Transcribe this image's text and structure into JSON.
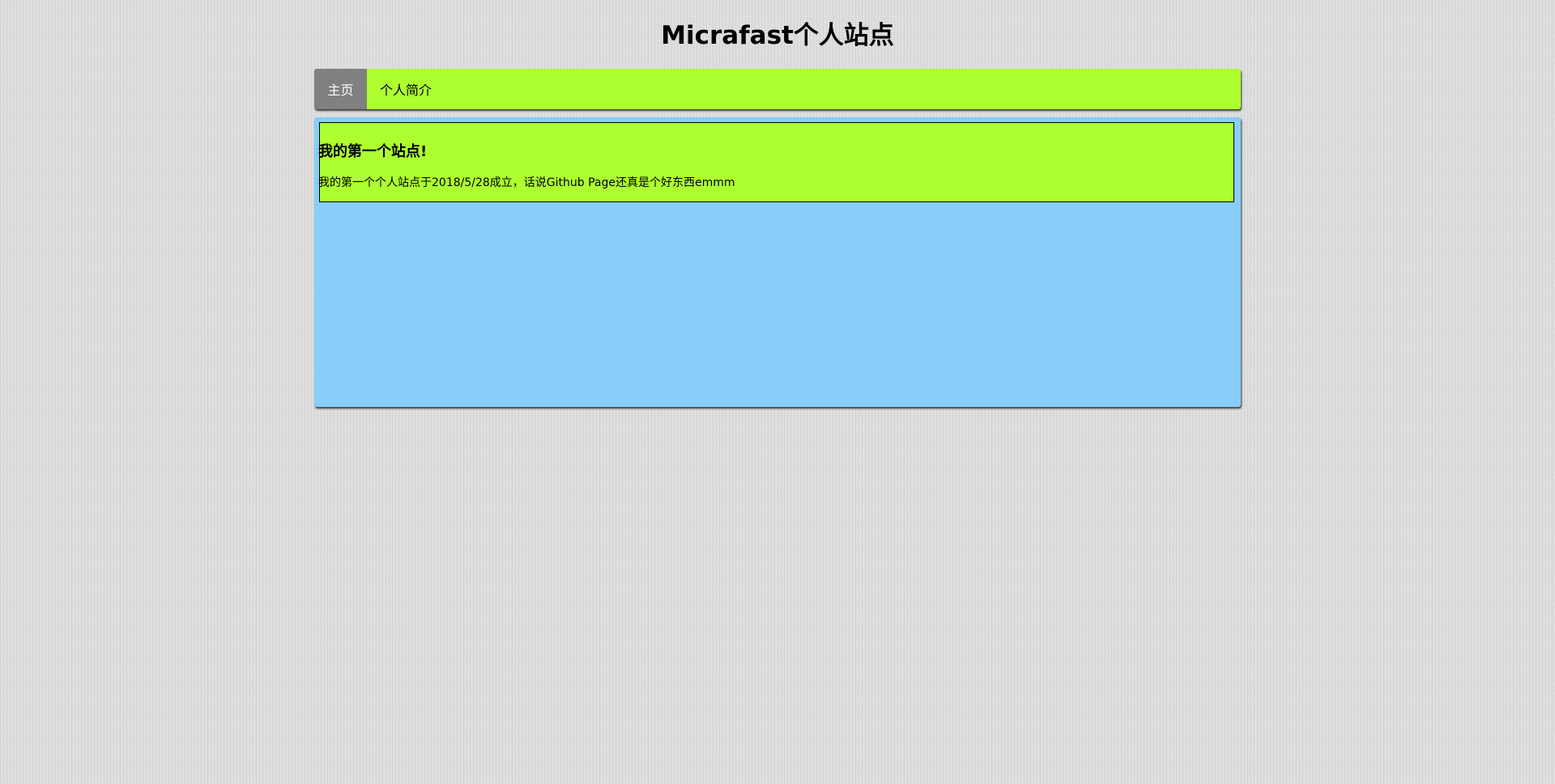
{
  "site": {
    "title": "Micrafast个人站点"
  },
  "nav": {
    "items": [
      {
        "label": "主页",
        "active": true
      },
      {
        "label": "个人简介",
        "active": false
      }
    ]
  },
  "post": {
    "title": "我的第一个站点!",
    "body": "我的第一个个人站点于2018/5/28成立，话说Github Page还真是个好东西emmm"
  },
  "colors": {
    "nav_background": "#adff2f",
    "nav_active_background": "#808080",
    "main_background": "#87cefa",
    "card_background": "#adff2f",
    "page_background": "#dcdcdc"
  }
}
